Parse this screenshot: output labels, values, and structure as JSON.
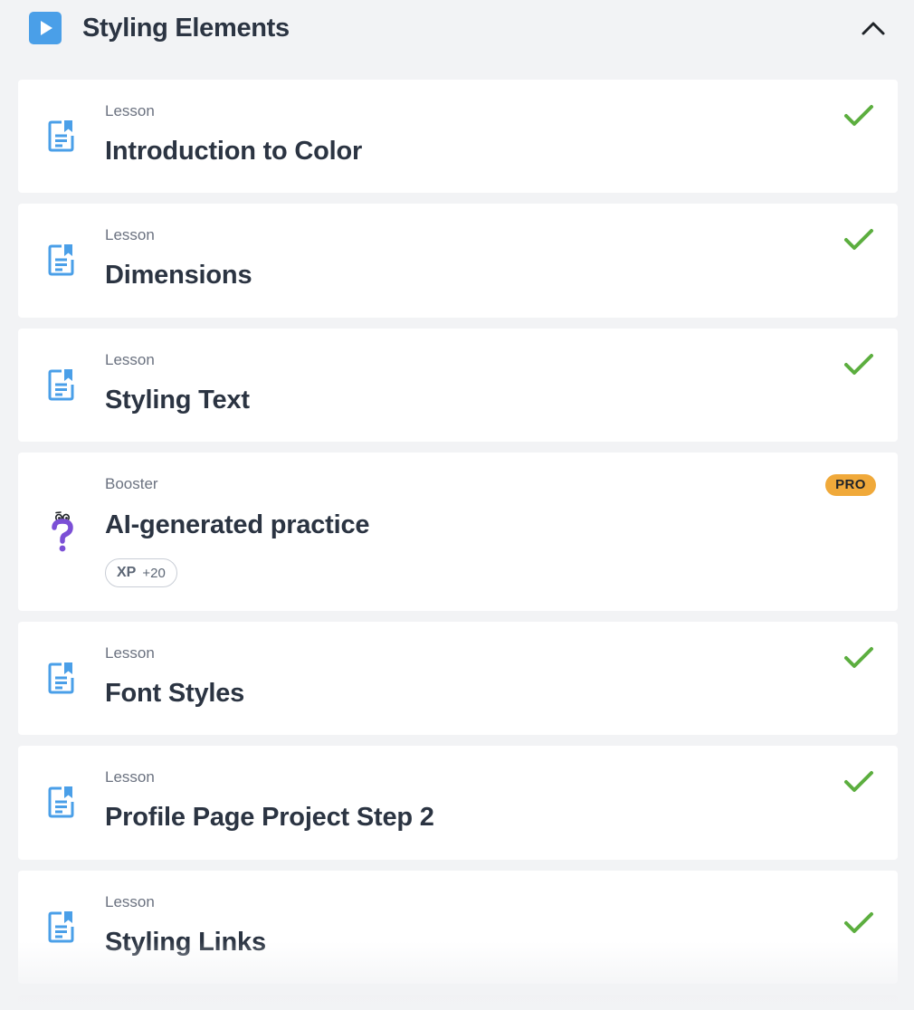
{
  "section": {
    "title": "Styling Elements",
    "play_icon": "play-icon",
    "toggle_icon": "chevron-up-icon"
  },
  "items": [
    {
      "kind": "Lesson",
      "title": "Introduction to Color",
      "icon": "document-icon",
      "status": "completed"
    },
    {
      "kind": "Lesson",
      "title": "Dimensions",
      "icon": "document-icon",
      "status": "completed"
    },
    {
      "kind": "Lesson",
      "title": "Styling Text",
      "icon": "document-icon",
      "status": "completed"
    },
    {
      "kind": "Booster",
      "title": "AI-generated practice",
      "icon": "question-mark-icon",
      "badge": "PRO",
      "xp_label": "XP",
      "xp_value": "+20"
    },
    {
      "kind": "Lesson",
      "title": "Font Styles",
      "icon": "document-icon",
      "status": "completed"
    },
    {
      "kind": "Lesson",
      "title": "Profile Page Project Step 2",
      "icon": "document-icon",
      "status": "completed"
    },
    {
      "kind": "Lesson",
      "title": "Styling Links",
      "icon": "document-icon",
      "status": "completed"
    }
  ],
  "colors": {
    "accent_blue": "#4a9fe8",
    "check_green": "#5cae3f",
    "pro_orange": "#f0a93a",
    "booster_purple": "#7b4fd6",
    "background": "#f2f3f5"
  }
}
